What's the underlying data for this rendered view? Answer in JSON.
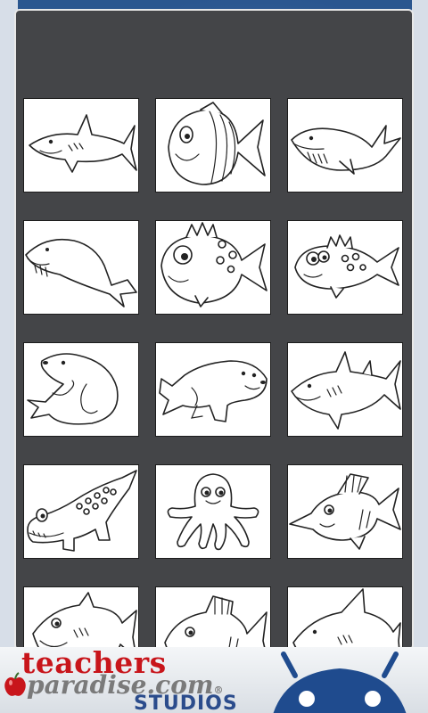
{
  "dialog": {
    "thumbnails": [
      {
        "subject": "shark"
      },
      {
        "subject": "striped-fish"
      },
      {
        "subject": "whale"
      },
      {
        "subject": "whale"
      },
      {
        "subject": "spotted-fish"
      },
      {
        "subject": "spotted-fish"
      },
      {
        "subject": "seal"
      },
      {
        "subject": "seal"
      },
      {
        "subject": "shark"
      },
      {
        "subject": "crocodile"
      },
      {
        "subject": "octopus"
      },
      {
        "subject": "swordfish"
      },
      {
        "subject": "shark"
      },
      {
        "subject": "fish"
      },
      {
        "subject": "shark"
      }
    ]
  },
  "banner": {
    "brand_line1": "teachers",
    "brand_line2": "paradise.com",
    "registered_mark": "®",
    "brand_line3": "STUDIOS",
    "colors": {
      "red": "#c8151b",
      "gray": "#7a7a7a",
      "blue": "#2b4c8c",
      "android": "#1f4b8e"
    }
  }
}
